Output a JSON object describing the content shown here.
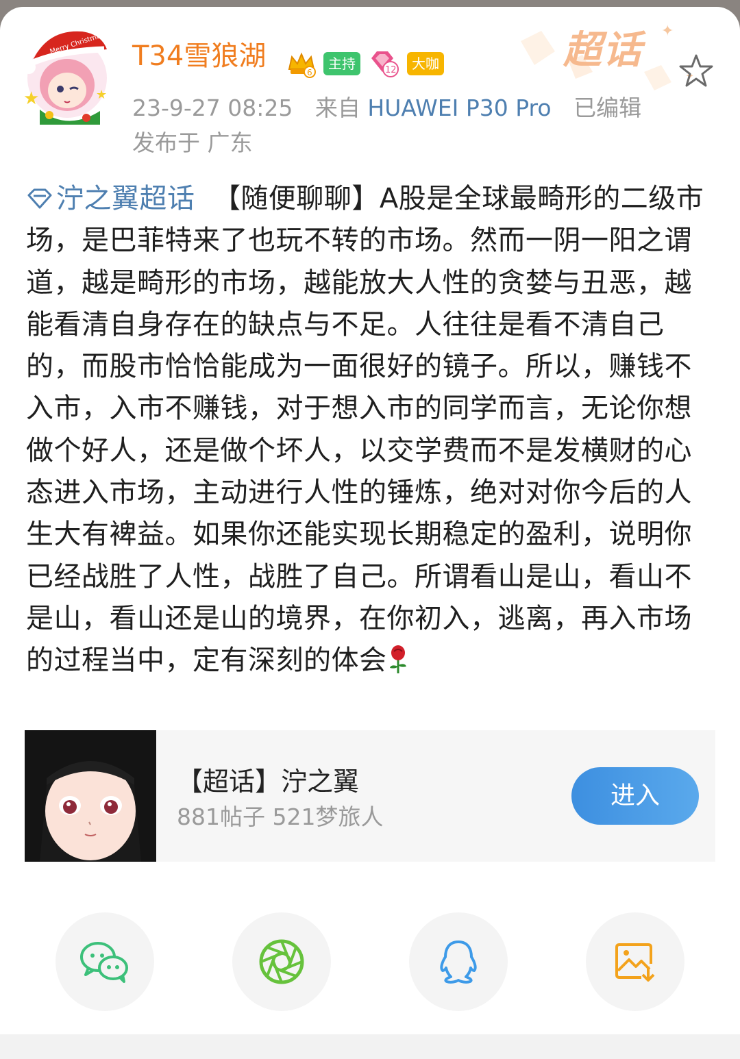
{
  "header": {
    "username": "T34雪狼湖",
    "level_badge": "6",
    "host_badge": "主持",
    "fan_badge": "12",
    "vip_badge": "大咖",
    "timestamp": "23-9-27 08:25",
    "from_prefix": "来自",
    "device": "HUAWEI P30 Pro",
    "edited": "已编辑",
    "location": "发布于 广东",
    "brand_logo": "超话",
    "avatar_text": "Merry Christmas"
  },
  "post": {
    "topic": "泞之翼超话",
    "text": "【随便聊聊】A股是全球最畸形的二级市场，是巴菲特来了也玩不转的市场。然而一阴一阳之谓道，越是畸形的市场，越能放大人性的贪婪与丑恶，越能看清自身存在的缺点与不足。人往往是看不清自己的，而股市恰恰能成为一面很好的镜子。所以，赚钱不入市，入市不赚钱，对于想入市的同学而言，无论你想做个好人，还是做个坏人，以交学费而不是发横财的心态进入市场，主动进行人性的锤炼，绝对对你今后的人生大有裨益。如果你还能实现长期稳定的盈利，说明你已经战胜了人性，战胜了自己。所谓看山是山，看山不是山，看山还是山的境界，在你初入，逃离，再入市场的过程当中，定有深刻的体会"
  },
  "card": {
    "title": "【超话】泞之翼",
    "stats": "881帖子 521梦旅人",
    "enter_label": "进入"
  },
  "share": {
    "icons": [
      "wechat-icon",
      "moments-icon",
      "qq-icon",
      "save-image-icon"
    ]
  },
  "colors": {
    "username": "#f07d1f",
    "link": "#4e7fb0",
    "enter_button": "#4a9be6",
    "wechat": "#3cc07a",
    "moments": "#66c23c",
    "qq": "#3d9ae8",
    "save": "#f3a21b"
  }
}
